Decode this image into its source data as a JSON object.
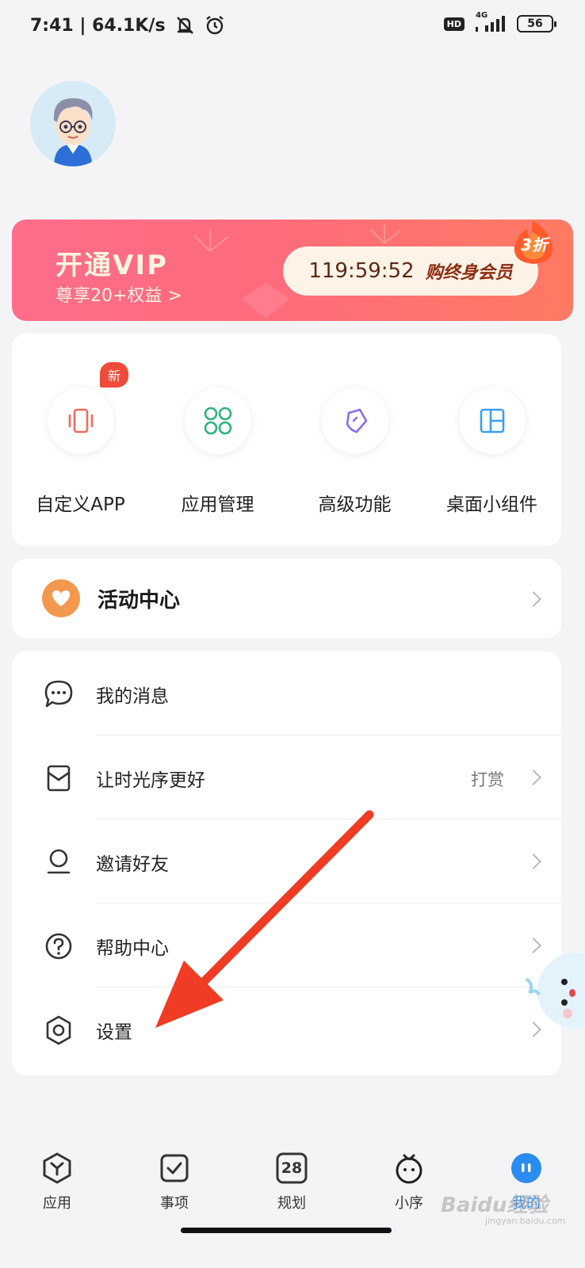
{
  "status_bar": {
    "time_speed": "7:41 | 64.1K/s",
    "hd": "HD",
    "network": "4G",
    "battery": "56"
  },
  "vip": {
    "title": "开通VIP",
    "subtitle": "尊享20+权益 >",
    "timer": "119:59:52",
    "cta": "购终身会员",
    "discount": "3折"
  },
  "shortcuts": [
    {
      "label": "自定义APP",
      "badge": "新",
      "icon": "phone-vibrate-icon",
      "color": "#f06a5e"
    },
    {
      "label": "应用管理",
      "icon": "apps-grid-icon",
      "color": "#2db37a"
    },
    {
      "label": "高级功能",
      "icon": "pen-tool-icon",
      "color": "#8b6cf0"
    },
    {
      "label": "桌面小组件",
      "icon": "widget-layout-icon",
      "color": "#3b9ef2"
    }
  ],
  "activity": {
    "label": "活动中心",
    "icon": "heart-icon",
    "color": "#f5984f"
  },
  "menu": [
    {
      "label": "我的消息",
      "icon": "message-icon",
      "extra": ""
    },
    {
      "label": "让时光序更好",
      "icon": "mail-heart-icon",
      "extra": "打赏"
    },
    {
      "label": "邀请好友",
      "icon": "user-icon",
      "extra": ""
    },
    {
      "label": "帮助中心",
      "icon": "help-icon",
      "extra": ""
    },
    {
      "label": "设置",
      "icon": "settings-icon",
      "extra": ""
    }
  ],
  "tabs": [
    {
      "label": "应用",
      "icon": "apps-hex-icon",
      "active": false
    },
    {
      "label": "事项",
      "icon": "checkbox-icon",
      "active": false
    },
    {
      "label": "规划",
      "icon": "calendar-icon",
      "active": false,
      "icon_text": "28"
    },
    {
      "label": "小序",
      "icon": "mascot-icon",
      "active": false
    },
    {
      "label": "我的",
      "icon": "profile-icon",
      "active": true
    }
  ],
  "watermark": {
    "brand": "Baidu经验",
    "url": "jingyan.baidu.com"
  },
  "colors": {
    "accent": "#2a8cf0",
    "arrow": "#f03c24",
    "vip_gradient_start": "#ff6d8a",
    "vip_gradient_end": "#ff7a62"
  }
}
